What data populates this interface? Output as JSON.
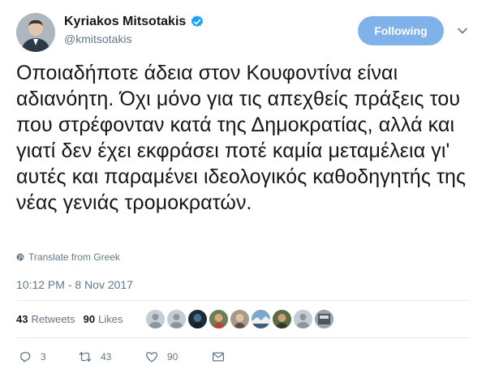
{
  "author": {
    "display_name": "Kyriakos Mitsotakis",
    "handle": "@kmitsotakis",
    "verified": true
  },
  "follow_button": {
    "label": "Following"
  },
  "tweet": {
    "text": "Οποιαδήποτε άδεια στον Κουφοντίνα είναι αδιανόητη. Όχι μόνο για τις απεχθείς πράξεις του που στρέφονταν κατά της Δημοκρατίας, αλλά και γιατί δεν έχει εκφράσει ποτέ καμία μεταμέλεια γι' αυτές και παραμένει ιδεολογικός καθοδηγητής της νέας γενιάς τρομοκρατών.",
    "translate_label": "Translate from Greek",
    "timestamp": "10:12 PM - 8 Nov 2017"
  },
  "stats": {
    "retweets_count": "43",
    "retweets_label": "Retweets",
    "likes_count": "90",
    "likes_label": "Likes"
  },
  "likers": [
    "liker-1",
    "liker-2",
    "liker-3",
    "liker-4",
    "liker-5",
    "liker-6",
    "liker-7",
    "liker-8",
    "liker-9"
  ],
  "actions": {
    "reply_count": "3",
    "retweet_count": "43",
    "like_count": "90"
  },
  "colors": {
    "follow_button_bg": "#7fb2ea",
    "verified_blue": "#1da1f2",
    "muted_text": "#657786",
    "divider": "#e6ecf0"
  },
  "icons": [
    "verified-icon",
    "chevron-down-icon",
    "globe-icon",
    "reply-icon",
    "retweet-icon",
    "like-icon",
    "direct-message-icon"
  ]
}
